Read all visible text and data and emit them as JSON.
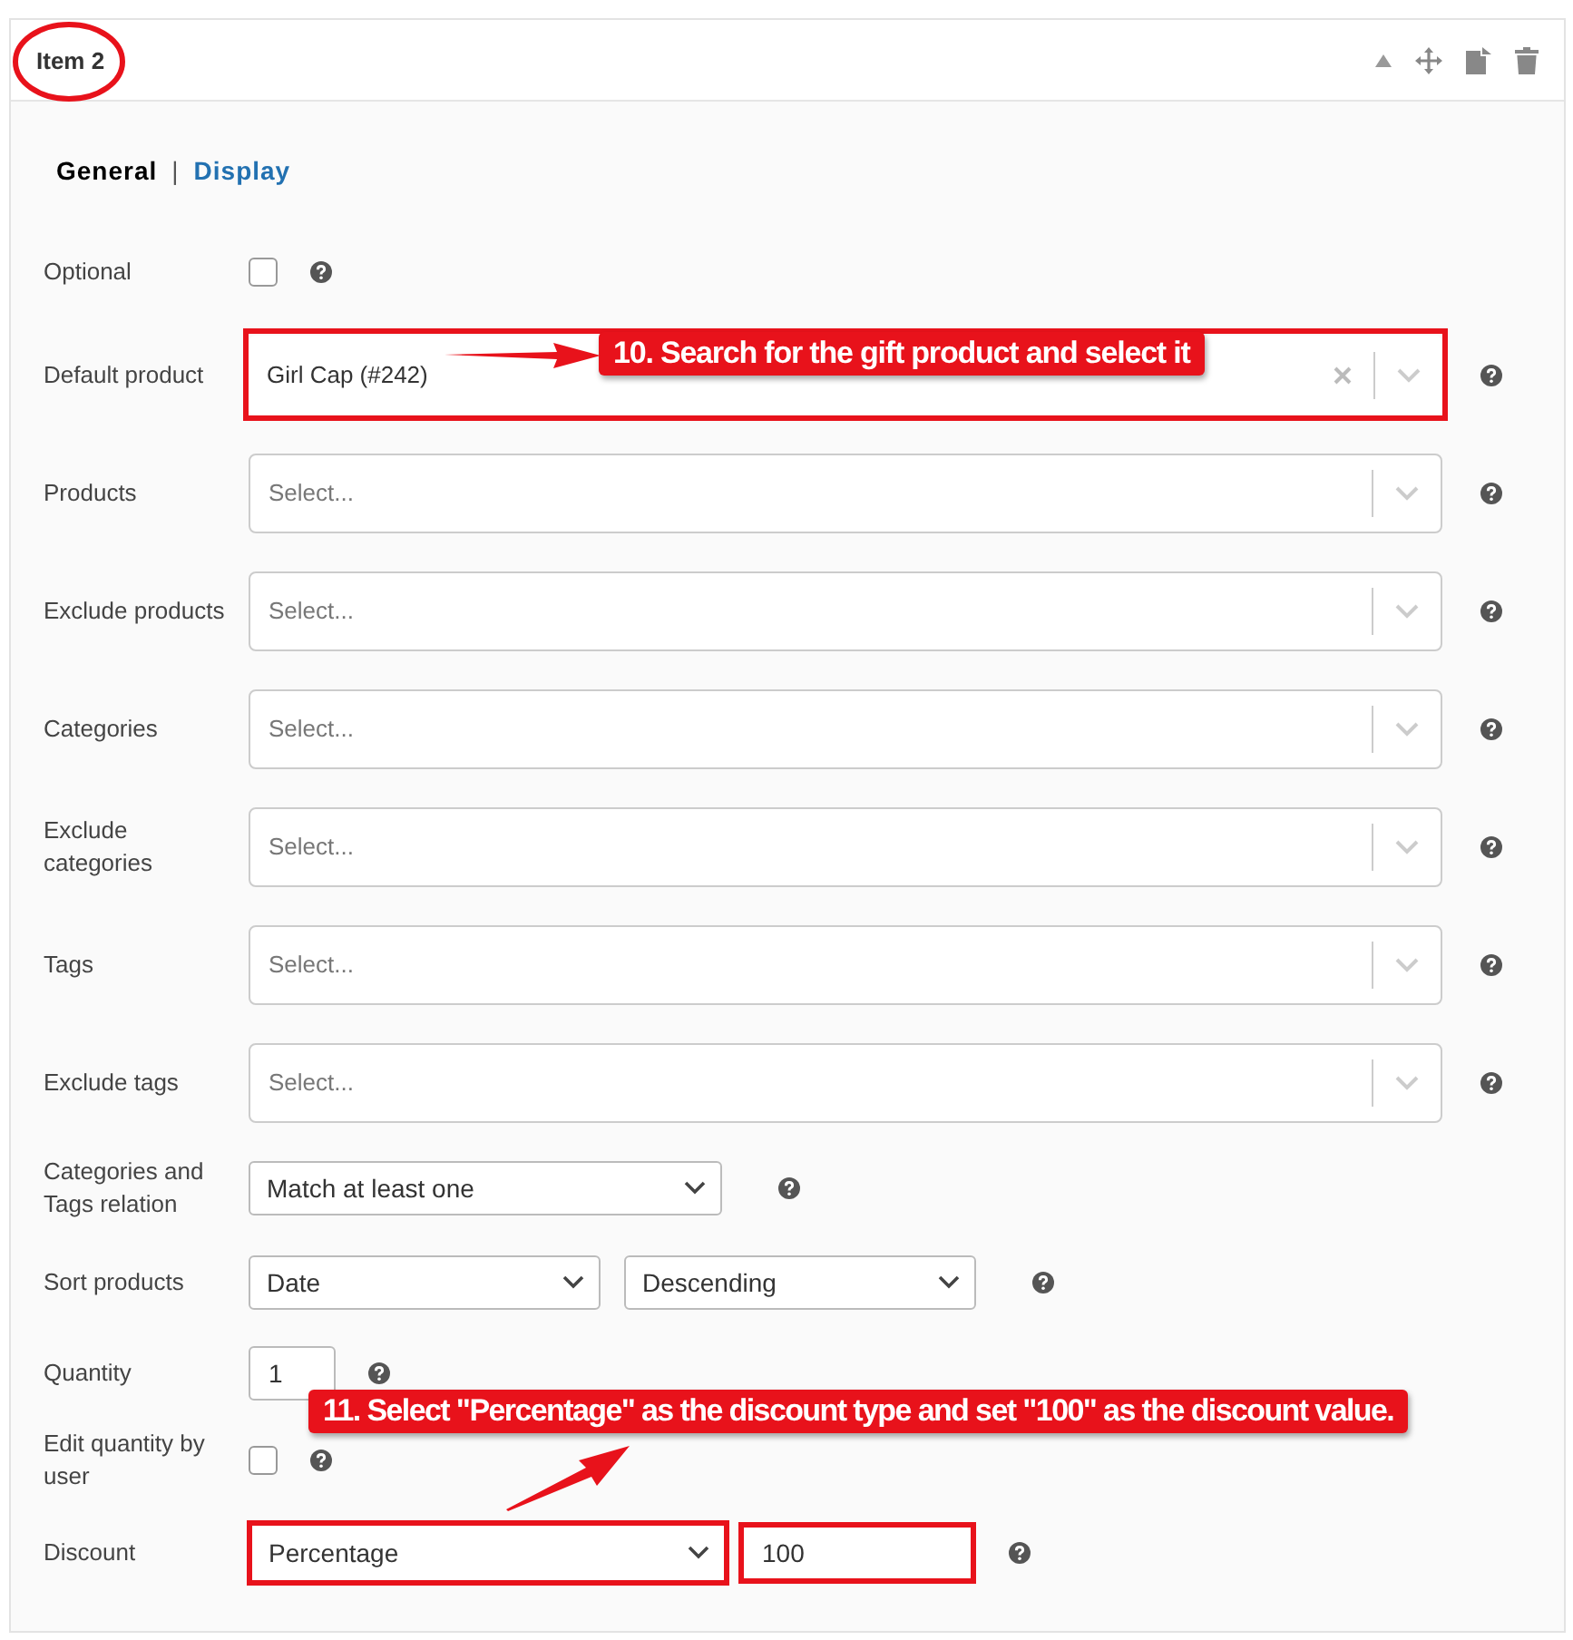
{
  "header": {
    "title": "Item 2",
    "circled": true
  },
  "tabs": [
    {
      "label": "General",
      "selected": true
    },
    {
      "label": "Display",
      "selected": false
    }
  ],
  "tab_separator": "|",
  "rows": [
    {
      "kind": "checkbox",
      "label": "Optional",
      "checked": false
    },
    {
      "kind": "select2",
      "label": "Default product",
      "value": "Girl Cap (#242)",
      "clearable": true,
      "highlighted": true
    },
    {
      "kind": "select2",
      "label": "Products",
      "placeholder": "Select...",
      "clearable": false
    },
    {
      "kind": "select2",
      "label": "Exclude products",
      "placeholder": "Select...",
      "clearable": false
    },
    {
      "kind": "select2",
      "label": "Categories",
      "placeholder": "Select...",
      "clearable": false
    },
    {
      "kind": "select2",
      "label": "Exclude categories",
      "placeholder": "Select...",
      "clearable": false
    },
    {
      "kind": "select2",
      "label": "Tags",
      "placeholder": "Select...",
      "clearable": false
    },
    {
      "kind": "select2",
      "label": "Exclude tags",
      "placeholder": "Select...",
      "clearable": false
    },
    {
      "kind": "select",
      "label": "Categories and Tags relation",
      "selects": [
        "Match at least one"
      ]
    },
    {
      "kind": "select",
      "label": "Sort products",
      "selects": [
        "Date",
        "Descending"
      ]
    },
    {
      "kind": "number",
      "label": "Quantity",
      "value": "1"
    },
    {
      "kind": "checkbox",
      "label": "Edit quantity by user",
      "checked": false
    },
    {
      "kind": "discount",
      "label": "Discount",
      "select": "Percentage",
      "value": "100",
      "highlighted": true
    }
  ],
  "annotations": [
    {
      "kind": "callout",
      "text": "10. Search for the gift product and select it"
    },
    {
      "kind": "callout",
      "text": "11. Select \"Percentage\" as the discount type and set \"100\" as the discount value."
    }
  ]
}
